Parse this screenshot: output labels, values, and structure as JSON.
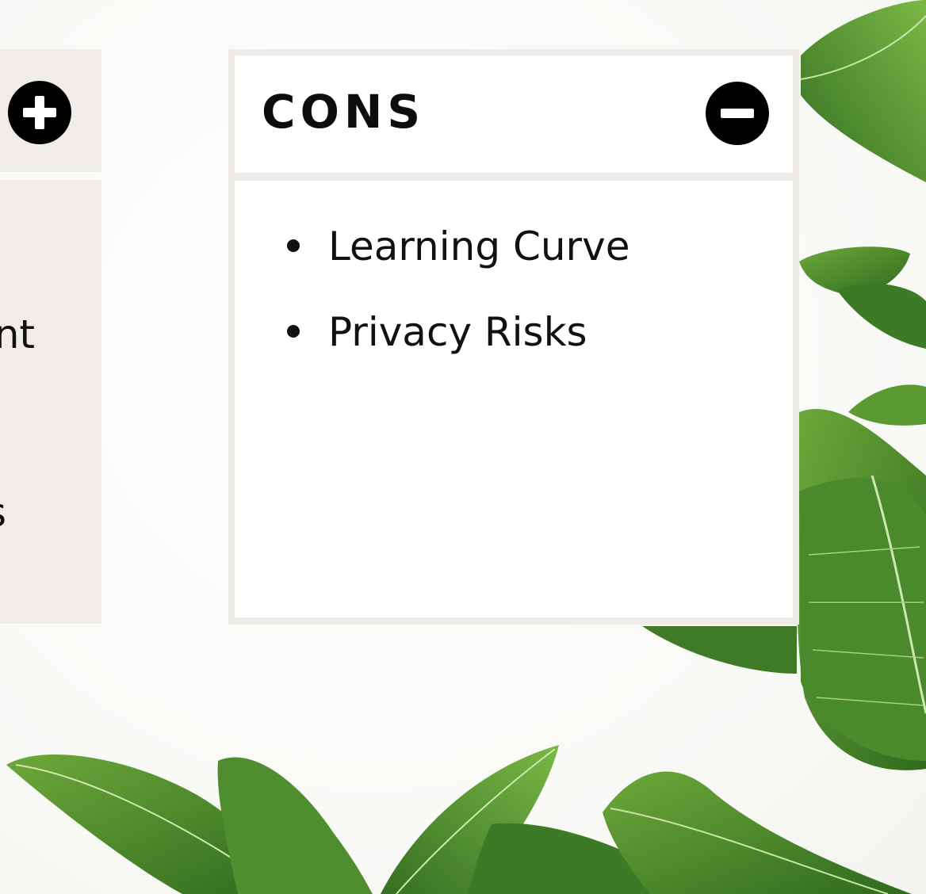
{
  "pros": {
    "items": [
      {
        "text": "nt"
      },
      {
        "text": "s"
      }
    ]
  },
  "cons": {
    "title": "CONS",
    "items": [
      {
        "text": "Learning Curve"
      },
      {
        "text": "Privacy Risks"
      }
    ]
  },
  "icons": {
    "pros_toggle": "plus-circle-icon",
    "cons_toggle": "minus-circle-icon"
  },
  "colors": {
    "panel_border": "#efebe7",
    "pros_background": "#f0ece8",
    "icon": "#000000",
    "leaf_green": "#4f8a2b"
  }
}
